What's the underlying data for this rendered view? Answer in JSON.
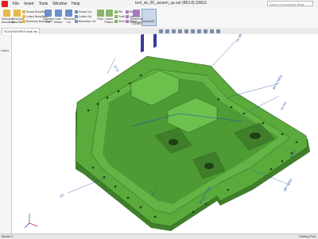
{
  "window": {
    "title": "tool_sk_00_assem_sp.sel (BDL8).SRES",
    "search_placeholder": "Search Knowledge Base"
  },
  "menu": [
    "File",
    "Insert",
    "Tools",
    "Window",
    "Help"
  ],
  "ribbon": {
    "extruded_boss": "Extruded Boss/Base",
    "revolved_boss": "Revolved Boss/Base",
    "swept_boss": "Swept Boss/Base",
    "lofted_boss": "Lofted Boss/Base",
    "boundary_boss": "Boundary Boss/Base",
    "extruded_cut": "Extruded Cut",
    "hole_wizard": "Hole Wizard",
    "revolved_cut": "Revolved Cut",
    "swept_cut": "Swept Cut",
    "lofted_cut": "Lofted Cut",
    "boundary_cut": "Boundary Cut",
    "fillet": "Fillet",
    "linear_pattern": "Linear Pattern",
    "rib": "Rib",
    "draft": "Draft",
    "shell": "Shell",
    "wrap": "Wrap",
    "intersect": "Intersect",
    "mirror": "Mirror",
    "reference_geometry": "Reference Geometry",
    "curves": "Curves",
    "instant3d": "Instant3D"
  },
  "tabs": {
    "active": "SOLIDWORKS Add-Ins"
  },
  "left_panel": {
    "label": "Colors"
  },
  "viewport": {
    "dimensions": [
      "2X Ø6.6 THRU",
      "Ø4.3 THRU",
      "4X R4",
      "2X 8",
      "Ø8 THRU",
      "R2",
      "2X 3",
      "6X R1",
      "M5x0.8 THRU"
    ]
  },
  "statusbar": {
    "left": "Model 1",
    "right": "Editing Part"
  },
  "colors": {
    "part_green": "#5aaa3c",
    "part_dark": "#3f7f2a",
    "dim_blue": "#3060b0"
  }
}
